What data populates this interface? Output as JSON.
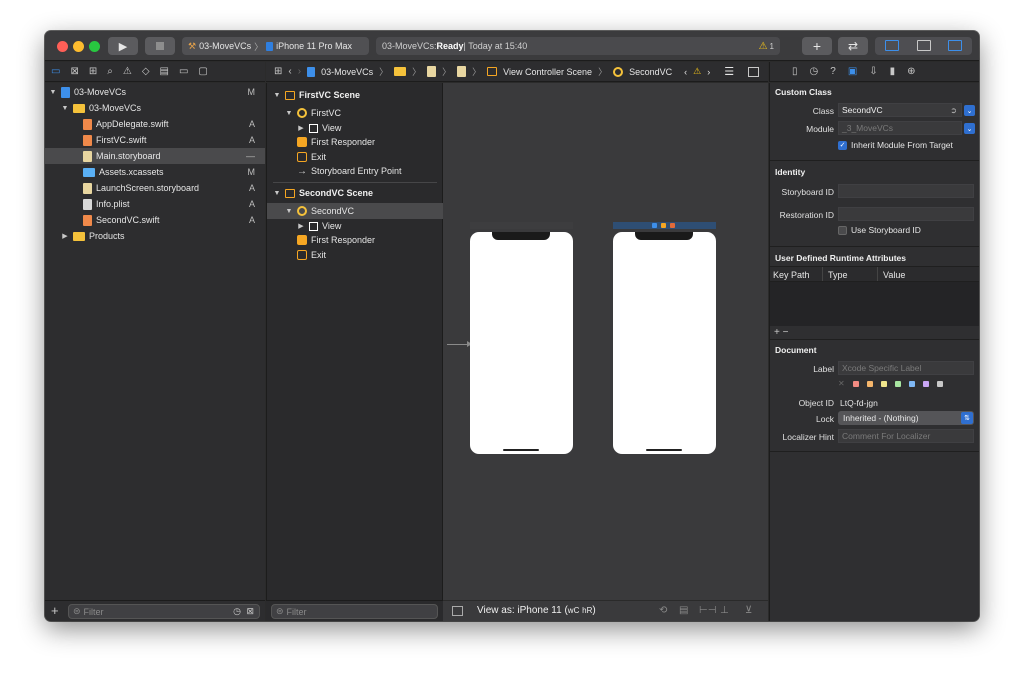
{
  "toolbar": {
    "scheme_project": "03-MoveVCs",
    "scheme_device": "iPhone 11 Pro Max",
    "activity_project": "03-MoveVCs: ",
    "activity_status": "Ready",
    "activity_time": " | Today at 15:40",
    "warning_count": "1",
    "add_label": "+",
    "swap_label": "⇄"
  },
  "navigator": {
    "items": [
      {
        "label": "03-MoveVCs",
        "status": "M"
      },
      {
        "label": "03-MoveVCs",
        "status": ""
      },
      {
        "label": "AppDelegate.swift",
        "status": "A"
      },
      {
        "label": "FirstVC.swift",
        "status": "A"
      },
      {
        "label": "Main.storyboard",
        "status": "—"
      },
      {
        "label": "Assets.xcassets",
        "status": "M"
      },
      {
        "label": "LaunchScreen.storyboard",
        "status": "A"
      },
      {
        "label": "Info.plist",
        "status": "A"
      },
      {
        "label": "SecondVC.swift",
        "status": "A"
      },
      {
        "label": "Products",
        "status": ""
      }
    ],
    "filter_placeholder": "Filter",
    "add_label": "+"
  },
  "jumpbar": {
    "crumbs": [
      "03-MoveVCs",
      "View Controller Scene",
      "SecondVC"
    ]
  },
  "outline": {
    "scene1_title": "FirstVC Scene",
    "scene1_vc": "FirstVC",
    "scene1_view": "View",
    "scene1_responder": "First Responder",
    "scene1_exit": "Exit",
    "scene1_entry": "Storyboard Entry Point",
    "scene2_title": "SecondVC Scene",
    "scene2_vc": "SecondVC",
    "scene2_view": "View",
    "scene2_responder": "First Responder",
    "scene2_exit": "Exit",
    "filter_placeholder": "Filter"
  },
  "canvas": {
    "view_as_prefix": "View as: iPhone 11 (",
    "view_as_wc": "wC",
    "view_as_hr": "hR",
    "view_as_suffix": ")"
  },
  "inspector": {
    "custom_class_title": "Custom Class",
    "class_label": "Class",
    "class_value": "SecondVC",
    "module_label": "Module",
    "module_value": "_3_MoveVCs",
    "inherit_label": "Inherit Module From Target",
    "identity_title": "Identity",
    "storyboard_id_label": "Storyboard ID",
    "restoration_id_label": "Restoration ID",
    "use_storyboard_id_label": "Use Storyboard ID",
    "runtime_title": "User Defined Runtime Attributes",
    "col_key": "Key Path",
    "col_type": "Type",
    "col_value": "Value",
    "add_remove": "+  −",
    "document_title": "Document",
    "label_label": "Label",
    "label_placeholder": "Xcode Specific Label",
    "object_id_label": "Object ID",
    "object_id_value": "LtQ-fd-jgn",
    "lock_label": "Lock",
    "lock_value": "Inherited - (Nothing)",
    "localizer_label": "Localizer Hint",
    "localizer_placeholder": "Comment For Localizer"
  },
  "colors": {
    "accent": "#2f6fd0",
    "folder": "#f5c23b",
    "storyboard": "#f5a623",
    "swift_file": "#f0894a",
    "warning": "#f5c518"
  }
}
